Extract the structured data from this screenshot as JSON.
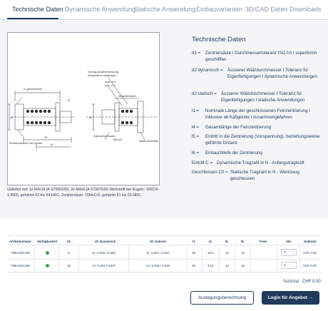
{
  "tabs": [
    {
      "label": "Technische Daten"
    },
    {
      "label": "Dynamische Anwendung"
    },
    {
      "label": "Statische Anwendung"
    },
    {
      "label": "Einbauvarianten"
    },
    {
      "label": "3D/CAD Daten"
    },
    {
      "label": "Downloads"
    }
  ],
  "drawing": {
    "labels": {
      "schnapp": "Schnappkopfverbindung",
      "eingestanzt": "eingestanzt ausbiegen",
      "max": "max. 0,5",
      "min": "min. 0,2",
      "gesch": "l1 geschlossen",
      "abstreif": "Abstreifmutter",
      "abstreif2": "Abstreifscheibe",
      "zyl": "Zylinderschraube",
      "m4": "M4x16",
      "sockel": "Einbauvariante mit Sockel",
      "l3": "l3",
      "l5": "l5",
      "l6": "l6",
      "d1": "d1",
      "d2": "d2"
    }
  },
  "delivered_text": "Geliefert mit: 1x M4x16 (A-07000180), 2x M4x8 (A-07007530) Werkstoff der Kugeln: 100Cr6 - 1.3505, gehärtet 62 bis 64 HRC; Zentriersäule: 16MnCr5, gehärtet 61 bis 63 HRC.",
  "specs": {
    "title": "Technische Daten",
    "rows": [
      {
        "key": "d1 =",
        "value": "Zentriersäule I Durchmessertoleranz ISO h3 I superfinish geschliffen"
      },
      {
        "key": "d2 dynamisch =",
        "value": "Äusserer Wälzdurchmesser I Toleranz für Eigenfertigungen I dynamische Anwendungen"
      },
      {
        "key": "d2 statisch =",
        "value": "Äusserer Wälzdurchmesser I Toleranz für Eigenfertigungen I statische Anwendungen"
      },
      {
        "key": "l1 =",
        "value": "Nominale Länge der geschlossenen Feinzentrierung I inklusive ab Käfigende I zusammengefahren"
      },
      {
        "key": "l4 =",
        "value": "Gesamtlänge der Feinzentrierung"
      },
      {
        "key": "l5 =",
        "value": "Eintritt in die Zentrierung (Vorspannung), beziehungsweise geführte Distanz"
      },
      {
        "key": "l6 =",
        "value": "Eintauchtiefe der Zentrierung"
      },
      {
        "key": "Eintritt C =",
        "value": "Dynamische Tragzahl in N - Anfangstragkraft"
      },
      {
        "key": "Geschlossen C0 =",
        "value": "Statische Tragzahl in N - Werkzeug geschlossen"
      }
    ]
  },
  "table": {
    "headers": [
      "Artikelnummer",
      "Verfügbarkeit",
      "d1",
      "d2 dynamisch",
      "d2 statisch",
      "l1",
      "l4",
      "l5",
      "l6",
      "Preis",
      "Stk.",
      "Subtotal"
    ],
    "rows": [
      {
        "artikel": "7980.008.009",
        "d1": "8",
        "d2dyn": "11 -0,002 / 0,006",
        "d2stat": "11 -0,001 / 0,007",
        "l1": "29",
        "l4": "34.5",
        "l5": "12",
        "l6": "15",
        "preis": "",
        "qty": "0",
        "subtotal": "CHF 0.00"
      },
      {
        "artikel": "7980.010.009",
        "d1": "10",
        "d2dyn": "14 -0,003 / 0,007",
        "d2stat": "14 -0,002 / 0,010",
        "l1": "29",
        "l4": "34.5",
        "l5": "12",
        "l6": "15",
        "preis": "",
        "qty": "0",
        "subtotal": "CHF 0.00"
      }
    ]
  },
  "subtotal": {
    "label": "Subtotal",
    "value": "CHF 0.00"
  },
  "buttons": {
    "quote": "Auslegungsberechnung",
    "login": "Login für Angebot  →"
  }
}
